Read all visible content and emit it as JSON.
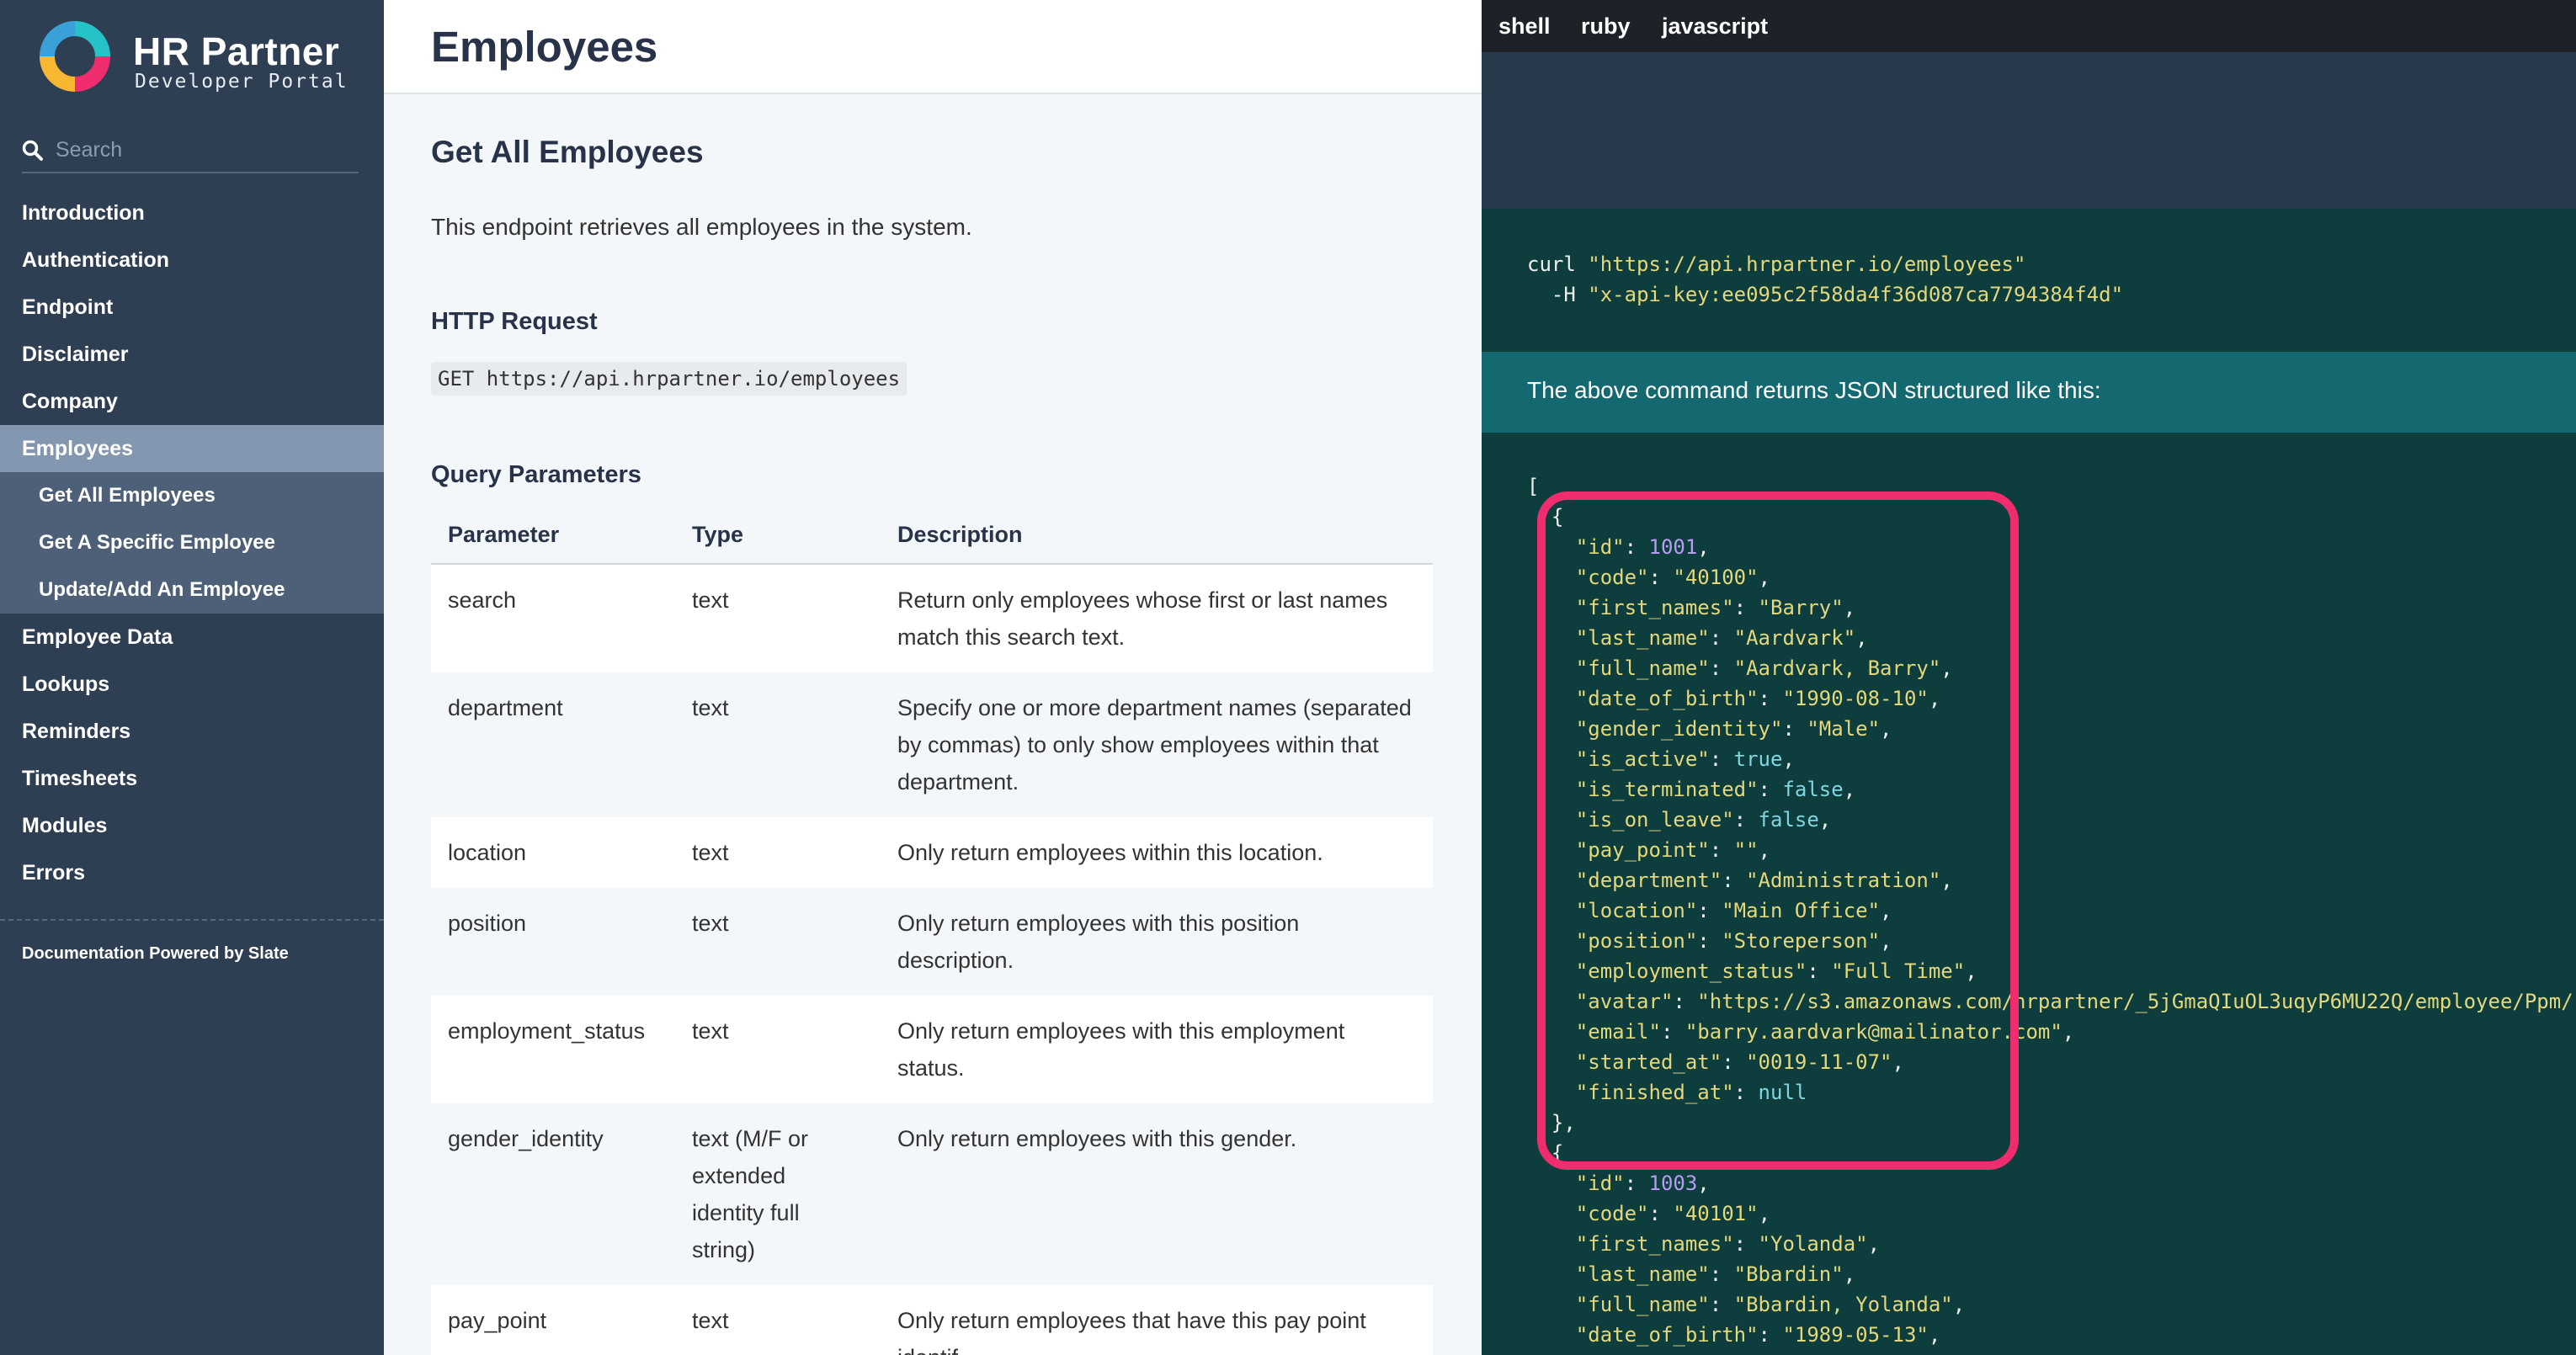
{
  "sidebar": {
    "brand": {
      "title": "HR Partner",
      "subtitle": "Developer Portal"
    },
    "search": {
      "placeholder": "Search"
    },
    "items": [
      {
        "label": "Introduction"
      },
      {
        "label": "Authentication"
      },
      {
        "label": "Endpoint"
      },
      {
        "label": "Disclaimer"
      },
      {
        "label": "Company"
      },
      {
        "label": "Employees",
        "active": true
      },
      {
        "label": "Employee Data"
      },
      {
        "label": "Lookups"
      },
      {
        "label": "Reminders"
      },
      {
        "label": "Timesheets"
      },
      {
        "label": "Modules"
      },
      {
        "label": "Errors"
      }
    ],
    "subitems": [
      {
        "label": "Get All Employees"
      },
      {
        "label": "Get A Specific Employee"
      },
      {
        "label": "Update/Add An Employee"
      }
    ],
    "powered_by": "Documentation Powered by Slate"
  },
  "main": {
    "page_title": "Employees",
    "section_title": "Get All Employees",
    "intro": "This endpoint retrieves all employees in the system.",
    "http_request_heading": "HTTP Request",
    "http_request": "GET https://api.hrpartner.io/employees",
    "query_params_heading": "Query Parameters",
    "table": {
      "headers": [
        "Parameter",
        "Type",
        "Description"
      ],
      "rows": [
        {
          "param": "search",
          "type": "text",
          "desc": "Return only employees whose first or last names match this search text."
        },
        {
          "param": "department",
          "type": "text",
          "desc": "Specify one or more department names (separated by commas) to only show employees within that department."
        },
        {
          "param": "location",
          "type": "text",
          "desc": "Only return employees within this location."
        },
        {
          "param": "position",
          "type": "text",
          "desc": "Only return employees with this position description."
        },
        {
          "param": "employment_status",
          "type": "text",
          "desc": "Only return employees with this employment status."
        },
        {
          "param": "gender_identity",
          "type": "text (M/F or extended identity full string)",
          "desc": "Only return employees with this gender."
        },
        {
          "param": "pay_point",
          "type": "text",
          "desc": "Only return employees that have this pay point identif"
        }
      ]
    }
  },
  "code_panel": {
    "tabs": [
      "shell",
      "ruby",
      "javascript"
    ],
    "curl": {
      "cmd": "curl",
      "url": "\"https://api.hrpartner.io/employees\"",
      "flag": "-H",
      "header": "\"x-api-key:ee095c2f58da4f36d087ca7794384f4d\""
    },
    "returns_text": "The above command returns JSON structured like this:",
    "json_records": [
      {
        "fields": [
          {
            "key": "id",
            "value": "1001",
            "kind": "n"
          },
          {
            "key": "code",
            "value": "\"40100\"",
            "kind": "s"
          },
          {
            "key": "first_names",
            "value": "\"Barry\"",
            "kind": "s"
          },
          {
            "key": "last_name",
            "value": "\"Aardvark\"",
            "kind": "s"
          },
          {
            "key": "full_name",
            "value": "\"Aardvark, Barry\"",
            "kind": "s"
          },
          {
            "key": "date_of_birth",
            "value": "\"1990-08-10\"",
            "kind": "s"
          },
          {
            "key": "gender_identity",
            "value": "\"Male\"",
            "kind": "s"
          },
          {
            "key": "is_active",
            "value": "true",
            "kind": "b"
          },
          {
            "key": "is_terminated",
            "value": "false",
            "kind": "b"
          },
          {
            "key": "is_on_leave",
            "value": "false",
            "kind": "b"
          },
          {
            "key": "pay_point",
            "value": "\"\"",
            "kind": "s"
          },
          {
            "key": "department",
            "value": "\"Administration\"",
            "kind": "s"
          },
          {
            "key": "location",
            "value": "\"Main Office\"",
            "kind": "s"
          },
          {
            "key": "position",
            "value": "\"Storeperson\"",
            "kind": "s"
          },
          {
            "key": "employment_status",
            "value": "\"Full Time\"",
            "kind": "s"
          },
          {
            "key": "avatar",
            "value": "\"https://s3.amazonaws.com/hrpartner/_5jGmaQIuOL3uqyP6MU22Q/employee/Ppm/",
            "kind": "s"
          },
          {
            "key": "email",
            "value": "\"barry.aardvark@mailinator.com\"",
            "kind": "s"
          },
          {
            "key": "started_at",
            "value": "\"0019-11-07\"",
            "kind": "s"
          },
          {
            "key": "finished_at",
            "value": "null",
            "kind": "b",
            "last": true
          }
        ]
      },
      {
        "fields": [
          {
            "key": "id",
            "value": "1003",
            "kind": "n"
          },
          {
            "key": "code",
            "value": "\"40101\"",
            "kind": "s"
          },
          {
            "key": "first_names",
            "value": "\"Yolanda\"",
            "kind": "s"
          },
          {
            "key": "last_name",
            "value": "\"Bbardin\"",
            "kind": "s"
          },
          {
            "key": "full_name",
            "value": "\"Bbardin, Yolanda\"",
            "kind": "s"
          },
          {
            "key": "date_of_birth",
            "value": "\"1989-05-13\"",
            "kind": "s"
          }
        ]
      }
    ],
    "colors": {
      "highlight": "#ef2d6e",
      "string": "#e4d77c",
      "number": "#b79cf2",
      "keyword": "#7fd6e0"
    }
  }
}
